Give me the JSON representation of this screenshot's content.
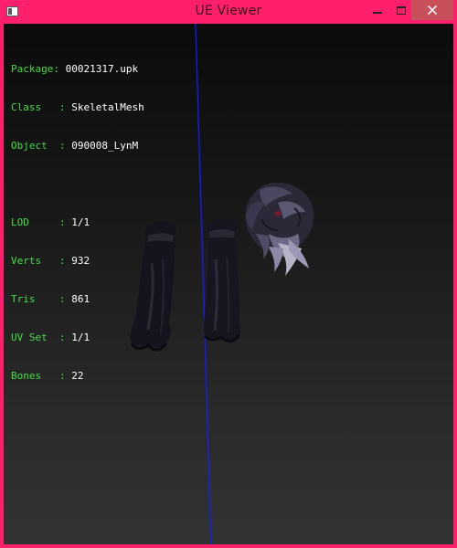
{
  "window": {
    "title": "UE Viewer",
    "icon": "app-icon",
    "controls": [
      "minimize-icon",
      "maximize-icon",
      "close-icon"
    ],
    "colors": {
      "frame": "#ff1f6b",
      "close_button": "#c7505a",
      "label_text": "#44dd44",
      "value_text": "#ffffff",
      "axis_line": "#1a1aff"
    }
  },
  "info": {
    "package": {
      "label": "Package: ",
      "value": "00021317.upk"
    },
    "class": {
      "label": "Class   : ",
      "value": "SkeletalMesh"
    },
    "object": {
      "label": "Object  : ",
      "value": "090008_LynM"
    },
    "lod": {
      "label": "LOD     : ",
      "value": "1/1"
    },
    "verts": {
      "label": "Verts   : ",
      "value": "932"
    },
    "tris": {
      "label": "Tris    : ",
      "value": "861"
    },
    "uvset": {
      "label": "UV Set  : ",
      "value": "1/1"
    },
    "bones": {
      "label": "Bones   : ",
      "value": "22"
    }
  }
}
